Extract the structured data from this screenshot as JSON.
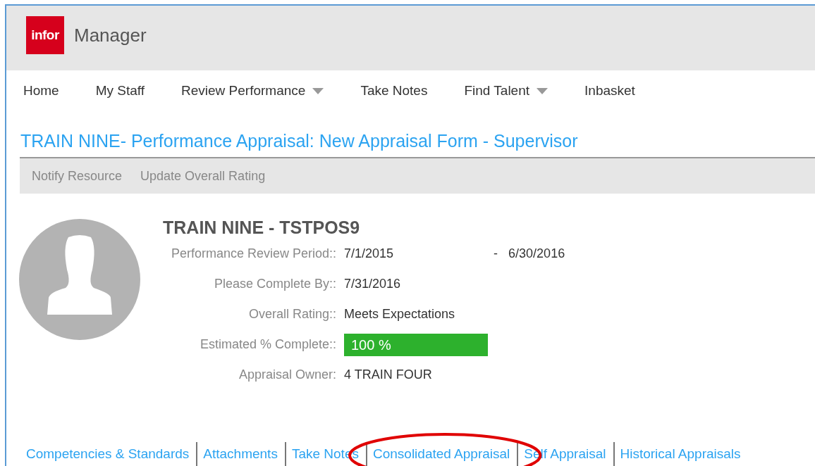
{
  "header": {
    "logo": "infor",
    "title": "Manager"
  },
  "nav": [
    {
      "label": "Home",
      "dropdown": false
    },
    {
      "label": "My Staff",
      "dropdown": false
    },
    {
      "label": "Review Performance",
      "dropdown": true
    },
    {
      "label": "Take Notes",
      "dropdown": false
    },
    {
      "label": "Find Talent",
      "dropdown": true
    },
    {
      "label": "Inbasket",
      "dropdown": false
    }
  ],
  "page_title": "TRAIN NINE- Performance Appraisal: New Appraisal Form - Supervisor",
  "actions": [
    "Notify Resource",
    "Update Overall Rating"
  ],
  "profile": {
    "name": "TRAIN NINE - TSTPOS9",
    "fields": [
      {
        "kind": "range",
        "label": "Performance Review Period::",
        "value": "7/1/2015",
        "separator": "-",
        "end": "6/30/2016"
      },
      {
        "kind": "text",
        "label": "Please Complete By::",
        "value": "7/31/2016"
      },
      {
        "kind": "text",
        "label": "Overall Rating::",
        "value": "Meets Expectations"
      },
      {
        "kind": "progress",
        "label": "Estimated % Complete::",
        "value": "100 %",
        "level": 1
      },
      {
        "kind": "text",
        "label": "Appraisal Owner:",
        "value": "4 TRAIN FOUR"
      }
    ]
  },
  "tabs": [
    {
      "label": "Competencies & Standards",
      "highlighted": false
    },
    {
      "label": "Attachments",
      "highlighted": false
    },
    {
      "label": "Take Notes",
      "highlighted": false
    },
    {
      "label": "Consolidated Appraisal",
      "highlighted": true
    },
    {
      "label": "Self Appraisal",
      "highlighted": false
    },
    {
      "label": "Historical Appraisals",
      "highlighted": false
    }
  ]
}
